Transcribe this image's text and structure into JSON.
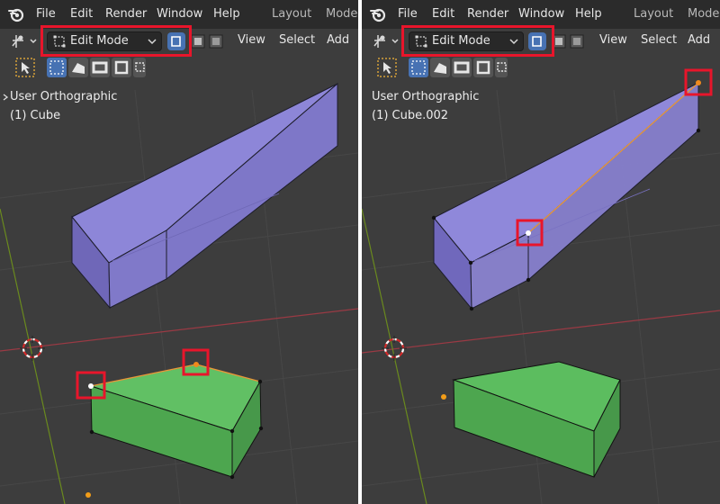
{
  "menu": {
    "items": [
      "File",
      "Edit",
      "Render",
      "Window",
      "Help"
    ],
    "workspaces": [
      "Layout",
      "Model"
    ]
  },
  "header": {
    "mode_label": "Edit Mode",
    "menus": [
      "View",
      "Select",
      "Add"
    ]
  },
  "viewport": {
    "view_name": "User Orthographic"
  },
  "panels": [
    {
      "object_label": "(1) Cube"
    },
    {
      "object_label": "(1) Cube.002"
    }
  ],
  "colors": {
    "highlight": "#e8152b",
    "viewport_bg": "#3d3d3d",
    "purple_mesh": "#8a82d6",
    "green_mesh": "#57b85a",
    "x_axis": "#9a3a44",
    "y_axis": "#6a8a1e",
    "accent_blue": "#4772b3"
  },
  "icons": [
    "blender-logo",
    "transform-icon",
    "mesh-mode-icon",
    "vertex-select-icon",
    "edge-select-icon",
    "face-select-icon",
    "cursor-tool-icon",
    "select-box-icon",
    "cursor-3d-icon",
    "object-origin-icon"
  ]
}
